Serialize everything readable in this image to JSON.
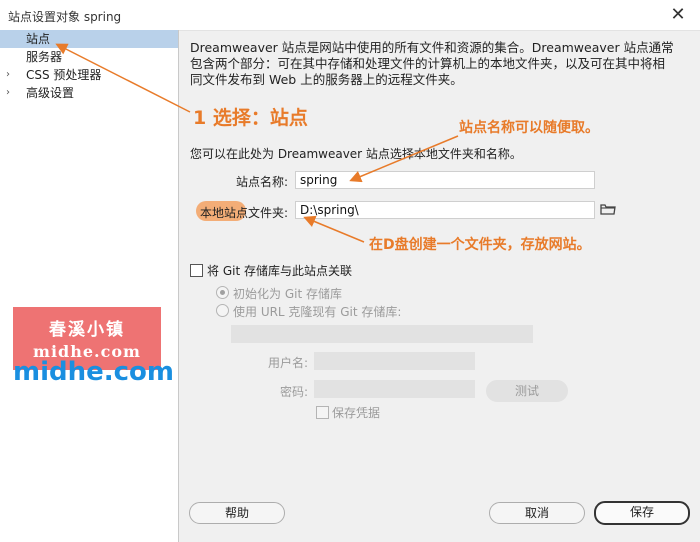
{
  "window": {
    "title": "站点设置对象 spring",
    "close_glyph": "✕"
  },
  "sidebar": {
    "items": [
      {
        "label": "站点",
        "selected": true,
        "expandable": false
      },
      {
        "label": "服务器",
        "selected": false,
        "expandable": false
      },
      {
        "label": "CSS 预处理器",
        "selected": false,
        "expandable": true
      },
      {
        "label": "高级设置",
        "selected": false,
        "expandable": true
      }
    ],
    "expand_glyph": "›"
  },
  "watermark": {
    "box_line1": "春溪小镇",
    "box_line2": "midhe.com",
    "text": "midhe.com",
    "box_color": "#ee7373",
    "text_color": "#1a8fe0"
  },
  "main": {
    "description": "Dreamweaver 站点是网站中使用的所有文件和资源的集合。Dreamweaver 站点通常包含两个部分：可在其中存储和处理文件的计算机上的本地文件夹，以及可在其中将相同文件发布到 Web 上的服务器上的远程文件夹。",
    "intro": "您可以在此处为 Dreamweaver 站点选择本地文件夹和名称。",
    "site_name_label": "站点名称:",
    "site_name_value": "spring",
    "local_folder_label": "本地站点文件夹:",
    "local_folder_value": "D:\\spring\\",
    "git": {
      "associate_label": "将 Git 存储库与此站点关联",
      "init_label": "初始化为 Git 存储库",
      "clone_label": "使用 URL 克隆现有 Git 存储库:",
      "url_value": "",
      "username_label": "用户名:",
      "username_value": "",
      "password_label": "密码:",
      "password_value": "",
      "test_button": "测试",
      "save_credentials_label": "保存凭据"
    }
  },
  "annotations": {
    "step": "1 选择：站点",
    "name_hint": "站点名称可以随便取。",
    "folder_hint": "在D盘创建一个文件夹，存放网站。",
    "color": "#e87b2a"
  },
  "footer": {
    "help_button": "帮助",
    "cancel_button": "取消",
    "save_button": "保存"
  }
}
